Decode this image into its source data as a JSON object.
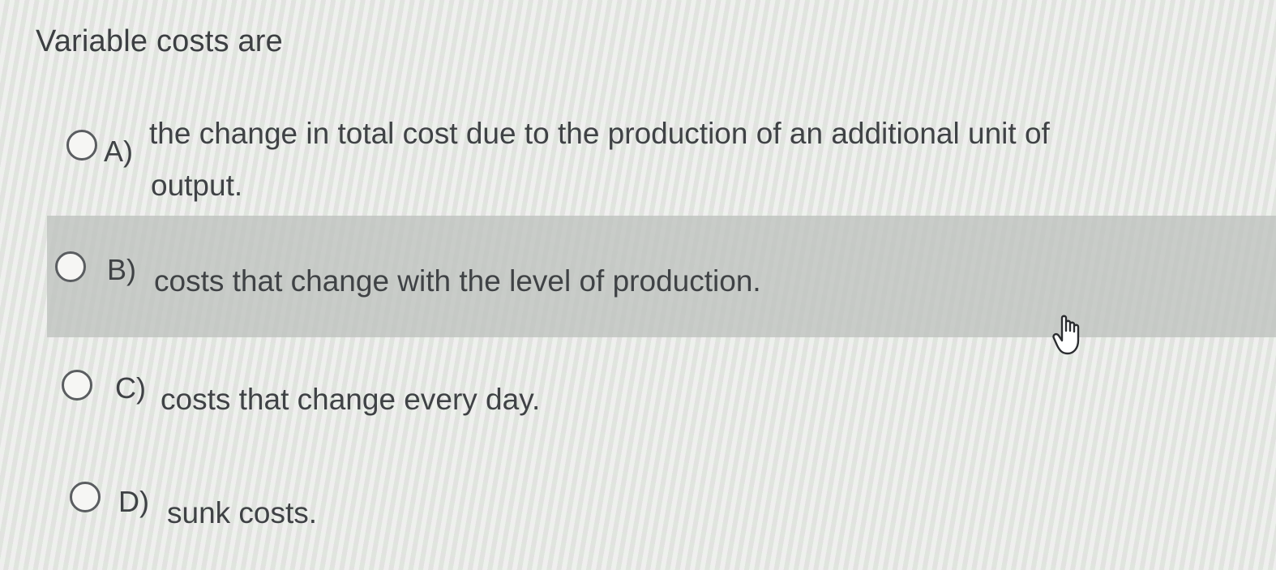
{
  "question": "Variable costs are",
  "options": [
    {
      "letter": "A)",
      "text_line1": "the change in total cost due to the production of an additional unit of",
      "text_line2": "output."
    },
    {
      "letter": "B)",
      "text": "costs that change with the level of production."
    },
    {
      "letter": "C)",
      "text": "costs that change every day."
    },
    {
      "letter": "D)",
      "text": "sunk costs."
    }
  ],
  "hovered_option": "B)",
  "icons": {
    "radio": "radio-empty-icon",
    "cursor": "hand-pointer-icon"
  }
}
